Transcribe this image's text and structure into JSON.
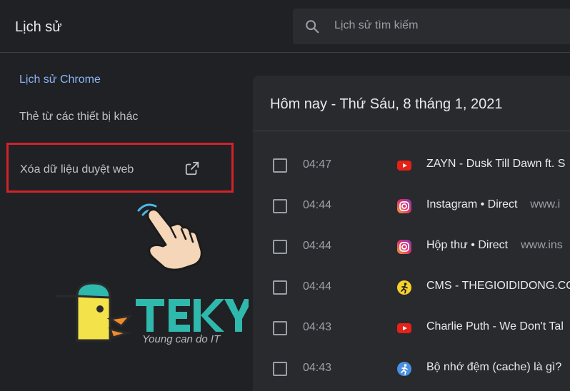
{
  "header": {
    "title": "Lịch sử",
    "search_placeholder": "Lịch sử tìm kiếm"
  },
  "sidebar": {
    "items": [
      {
        "label": "Lịch sử Chrome"
      },
      {
        "label": "Thẻ từ các thiết bị khác"
      },
      {
        "label": "Xóa dữ liệu duyệt web"
      }
    ]
  },
  "main": {
    "date_heading": "Hôm nay - Thứ Sáu, 8 tháng 1, 2021",
    "rows": [
      {
        "time": "04:47",
        "title": "ZAYN - Dusk Till Dawn ft. S",
        "domain": "",
        "icon": "youtube-icon"
      },
      {
        "time": "04:44",
        "title": "Instagram • Direct",
        "domain": "www.i",
        "icon": "instagram-icon"
      },
      {
        "time": "04:44",
        "title": "Hộp thư • Direct",
        "domain": "www.ins",
        "icon": "instagram-icon"
      },
      {
        "time": "04:44",
        "title": "CMS - THEGIOIDIDONG.CO",
        "domain": "",
        "icon": "cms-icon"
      },
      {
        "time": "04:43",
        "title": "Charlie Puth - We Don't Tal",
        "domain": "",
        "icon": "youtube-icon"
      },
      {
        "time": "04:43",
        "title": "Bộ nhớ đệm (cache) là gì?",
        "domain": "",
        "icon": "runner-icon"
      }
    ]
  },
  "logo": {
    "brand": "TEKY",
    "tagline": "Young can do IT"
  },
  "colors": {
    "accent": "#8ab4f8",
    "highlight_border": "#d0232a",
    "logo_teal": "#2fb8ac",
    "logo_yellow": "#f3e24a"
  }
}
